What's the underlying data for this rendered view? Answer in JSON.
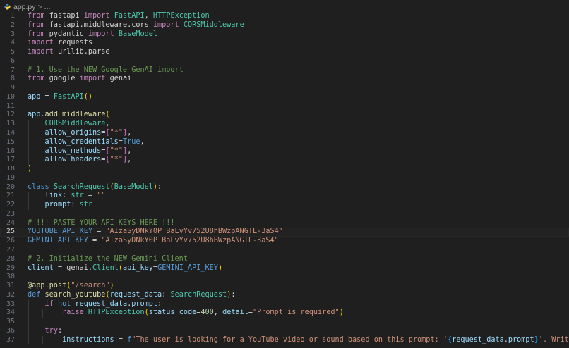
{
  "breadcrumb": {
    "file": "app.py",
    "separator": ">",
    "trail": "..."
  },
  "colors": {
    "background": "#1f1f1f",
    "keyword": "#c586c0",
    "storage": "#569cd6",
    "type": "#4ec9b0",
    "function": "#dcdcaa",
    "variable": "#9cdcfe",
    "string": "#ce9178",
    "number": "#b5cea8",
    "comment": "#6a9955"
  },
  "editor": {
    "current_line": 25,
    "lines": [
      {
        "n": "1",
        "tokens": [
          [
            "kw",
            "from"
          ],
          [
            "op",
            " fastapi "
          ],
          [
            "kw",
            "import"
          ],
          [
            "tp",
            " FastAPI"
          ],
          [
            "op",
            ", "
          ],
          [
            "tp",
            "HTTPException"
          ]
        ]
      },
      {
        "n": "2",
        "tokens": [
          [
            "kw",
            "from"
          ],
          [
            "op",
            " fastapi.middleware.cors "
          ],
          [
            "kw",
            "import"
          ],
          [
            "tp",
            " CORSMiddleware"
          ]
        ]
      },
      {
        "n": "3",
        "tokens": [
          [
            "kw",
            "from"
          ],
          [
            "op",
            " pydantic "
          ],
          [
            "kw",
            "import"
          ],
          [
            "tp",
            " BaseModel"
          ]
        ]
      },
      {
        "n": "4",
        "tokens": [
          [
            "kw",
            "import"
          ],
          [
            "op",
            " requests"
          ]
        ]
      },
      {
        "n": "5",
        "tokens": [
          [
            "kw",
            "import"
          ],
          [
            "op",
            " urllib.parse"
          ]
        ]
      },
      {
        "n": "6",
        "tokens": []
      },
      {
        "n": "7",
        "tokens": [
          [
            "cm",
            "# 1. Use the NEW Google GenAI import"
          ]
        ]
      },
      {
        "n": "8",
        "tokens": [
          [
            "kw",
            "from"
          ],
          [
            "op",
            " google "
          ],
          [
            "kw",
            "import"
          ],
          [
            "op",
            " genai"
          ]
        ]
      },
      {
        "n": "9",
        "tokens": []
      },
      {
        "n": "10",
        "tokens": [
          [
            "vr",
            "app"
          ],
          [
            "op",
            " = "
          ],
          [
            "tp",
            "FastAPI"
          ],
          [
            "br",
            "()"
          ]
        ]
      },
      {
        "n": "11",
        "tokens": []
      },
      {
        "n": "12",
        "tokens": [
          [
            "vr",
            "app"
          ],
          [
            "op",
            "."
          ],
          [
            "fn",
            "add_middleware"
          ],
          [
            "br",
            "("
          ]
        ]
      },
      {
        "n": "13",
        "tokens": [
          [
            "op",
            "    "
          ],
          [
            "tp",
            "CORSMiddleware"
          ],
          [
            "op",
            ","
          ]
        ]
      },
      {
        "n": "14",
        "tokens": [
          [
            "op",
            "    "
          ],
          [
            "vr",
            "allow_origins"
          ],
          [
            "op",
            "="
          ],
          [
            "br2",
            "["
          ],
          [
            "st",
            "\"*\""
          ],
          [
            "br2",
            "]"
          ],
          [
            "op",
            ","
          ]
        ]
      },
      {
        "n": "15",
        "tokens": [
          [
            "op",
            "    "
          ],
          [
            "vr",
            "allow_credentials"
          ],
          [
            "op",
            "="
          ],
          [
            "kb",
            "True"
          ],
          [
            "op",
            ","
          ]
        ]
      },
      {
        "n": "16",
        "tokens": [
          [
            "op",
            "    "
          ],
          [
            "vr",
            "allow_methods"
          ],
          [
            "op",
            "="
          ],
          [
            "br2",
            "["
          ],
          [
            "st",
            "\"*\""
          ],
          [
            "br2",
            "]"
          ],
          [
            "op",
            ","
          ]
        ]
      },
      {
        "n": "17",
        "tokens": [
          [
            "op",
            "    "
          ],
          [
            "vr",
            "allow_headers"
          ],
          [
            "op",
            "="
          ],
          [
            "br2",
            "["
          ],
          [
            "st",
            "\"*\""
          ],
          [
            "br2",
            "]"
          ],
          [
            "op",
            ","
          ]
        ]
      },
      {
        "n": "18",
        "tokens": [
          [
            "br",
            ")"
          ]
        ]
      },
      {
        "n": "19",
        "tokens": []
      },
      {
        "n": "20",
        "tokens": [
          [
            "kb",
            "class"
          ],
          [
            "op",
            " "
          ],
          [
            "tp",
            "SearchRequest"
          ],
          [
            "br",
            "("
          ],
          [
            "tp",
            "BaseModel"
          ],
          [
            "br",
            ")"
          ],
          [
            "op",
            ":"
          ]
        ]
      },
      {
        "n": "21",
        "tokens": [
          [
            "op",
            "    "
          ],
          [
            "vr",
            "link"
          ],
          [
            "op",
            ": "
          ],
          [
            "tp",
            "str"
          ],
          [
            "op",
            " = "
          ],
          [
            "st",
            "\"\""
          ]
        ]
      },
      {
        "n": "22",
        "tokens": [
          [
            "op",
            "    "
          ],
          [
            "vr",
            "prompt"
          ],
          [
            "op",
            ": "
          ],
          [
            "tp",
            "str"
          ]
        ]
      },
      {
        "n": "23",
        "tokens": []
      },
      {
        "n": "24",
        "tokens": [
          [
            "cm",
            "# !!! PASTE YOUR API KEYS HERE !!!"
          ]
        ]
      },
      {
        "n": "25",
        "tokens": [
          [
            "kb",
            "YOUTUBE_API_KEY"
          ],
          [
            "op",
            " = "
          ],
          [
            "st",
            "\"AIzaSyDNkY0P_BaLvYv752U8hBWzpANGTL-3aS4\""
          ]
        ]
      },
      {
        "n": "26",
        "tokens": [
          [
            "kb",
            "GEMINI_API_KEY"
          ],
          [
            "op",
            " = "
          ],
          [
            "st",
            "\"AIzaSyDNkY0P_BaLvYv752U8hBWzpANGTL-3aS4\""
          ]
        ]
      },
      {
        "n": "27",
        "tokens": []
      },
      {
        "n": "28",
        "tokens": [
          [
            "cm",
            "# 2. Initialize the NEW Gemini Client"
          ]
        ]
      },
      {
        "n": "29",
        "tokens": [
          [
            "vr",
            "client"
          ],
          [
            "op",
            " = "
          ],
          [
            "op",
            "genai."
          ],
          [
            "tp",
            "Client"
          ],
          [
            "br",
            "("
          ],
          [
            "vr",
            "api_key"
          ],
          [
            "op",
            "="
          ],
          [
            "kb",
            "GEMINI_API_KEY"
          ],
          [
            "br",
            ")"
          ]
        ]
      },
      {
        "n": "30",
        "tokens": []
      },
      {
        "n": "31",
        "tokens": [
          [
            "fn",
            "@app.post"
          ],
          [
            "br",
            "("
          ],
          [
            "st",
            "\"/search\""
          ],
          [
            "br",
            ")"
          ]
        ]
      },
      {
        "n": "32",
        "tokens": [
          [
            "kb",
            "def"
          ],
          [
            "op",
            " "
          ],
          [
            "fn",
            "search_youtube"
          ],
          [
            "br",
            "("
          ],
          [
            "vr",
            "request_data"
          ],
          [
            "op",
            ": "
          ],
          [
            "tp",
            "SearchRequest"
          ],
          [
            "br",
            ")"
          ],
          [
            "op",
            ":"
          ]
        ]
      },
      {
        "n": "33",
        "tokens": [
          [
            "op",
            "    "
          ],
          [
            "kw",
            "if"
          ],
          [
            "op",
            " "
          ],
          [
            "kb",
            "not"
          ],
          [
            "op",
            " "
          ],
          [
            "vr",
            "request_data"
          ],
          [
            "op",
            "."
          ],
          [
            "vr",
            "prompt"
          ],
          [
            "op",
            ":"
          ]
        ]
      },
      {
        "n": "34",
        "tokens": [
          [
            "op",
            "        "
          ],
          [
            "kw",
            "raise"
          ],
          [
            "op",
            " "
          ],
          [
            "tp",
            "HTTPException"
          ],
          [
            "br",
            "("
          ],
          [
            "vr",
            "status_code"
          ],
          [
            "op",
            "="
          ],
          [
            "nm",
            "400"
          ],
          [
            "op",
            ", "
          ],
          [
            "vr",
            "detail"
          ],
          [
            "op",
            "="
          ],
          [
            "st",
            "\"Prompt is required\""
          ],
          [
            "br",
            ")"
          ]
        ]
      },
      {
        "n": "35",
        "tokens": []
      },
      {
        "n": "36",
        "tokens": [
          [
            "op",
            "    "
          ],
          [
            "kw",
            "try"
          ],
          [
            "op",
            ":"
          ]
        ]
      },
      {
        "n": "37",
        "tokens": [
          [
            "op",
            "        "
          ],
          [
            "vr",
            "instructions"
          ],
          [
            "op",
            " = "
          ],
          [
            "kb",
            "f"
          ],
          [
            "st",
            "\"The user is looking for a YouTube video or sound based on this prompt: '"
          ],
          [
            "br3",
            "{"
          ],
          [
            "vr",
            "request_data"
          ],
          [
            "op",
            "."
          ],
          [
            "vr",
            "prompt"
          ],
          [
            "br3",
            "}"
          ],
          [
            "st",
            "'. Write a highly specific, op"
          ]
        ]
      }
    ]
  }
}
